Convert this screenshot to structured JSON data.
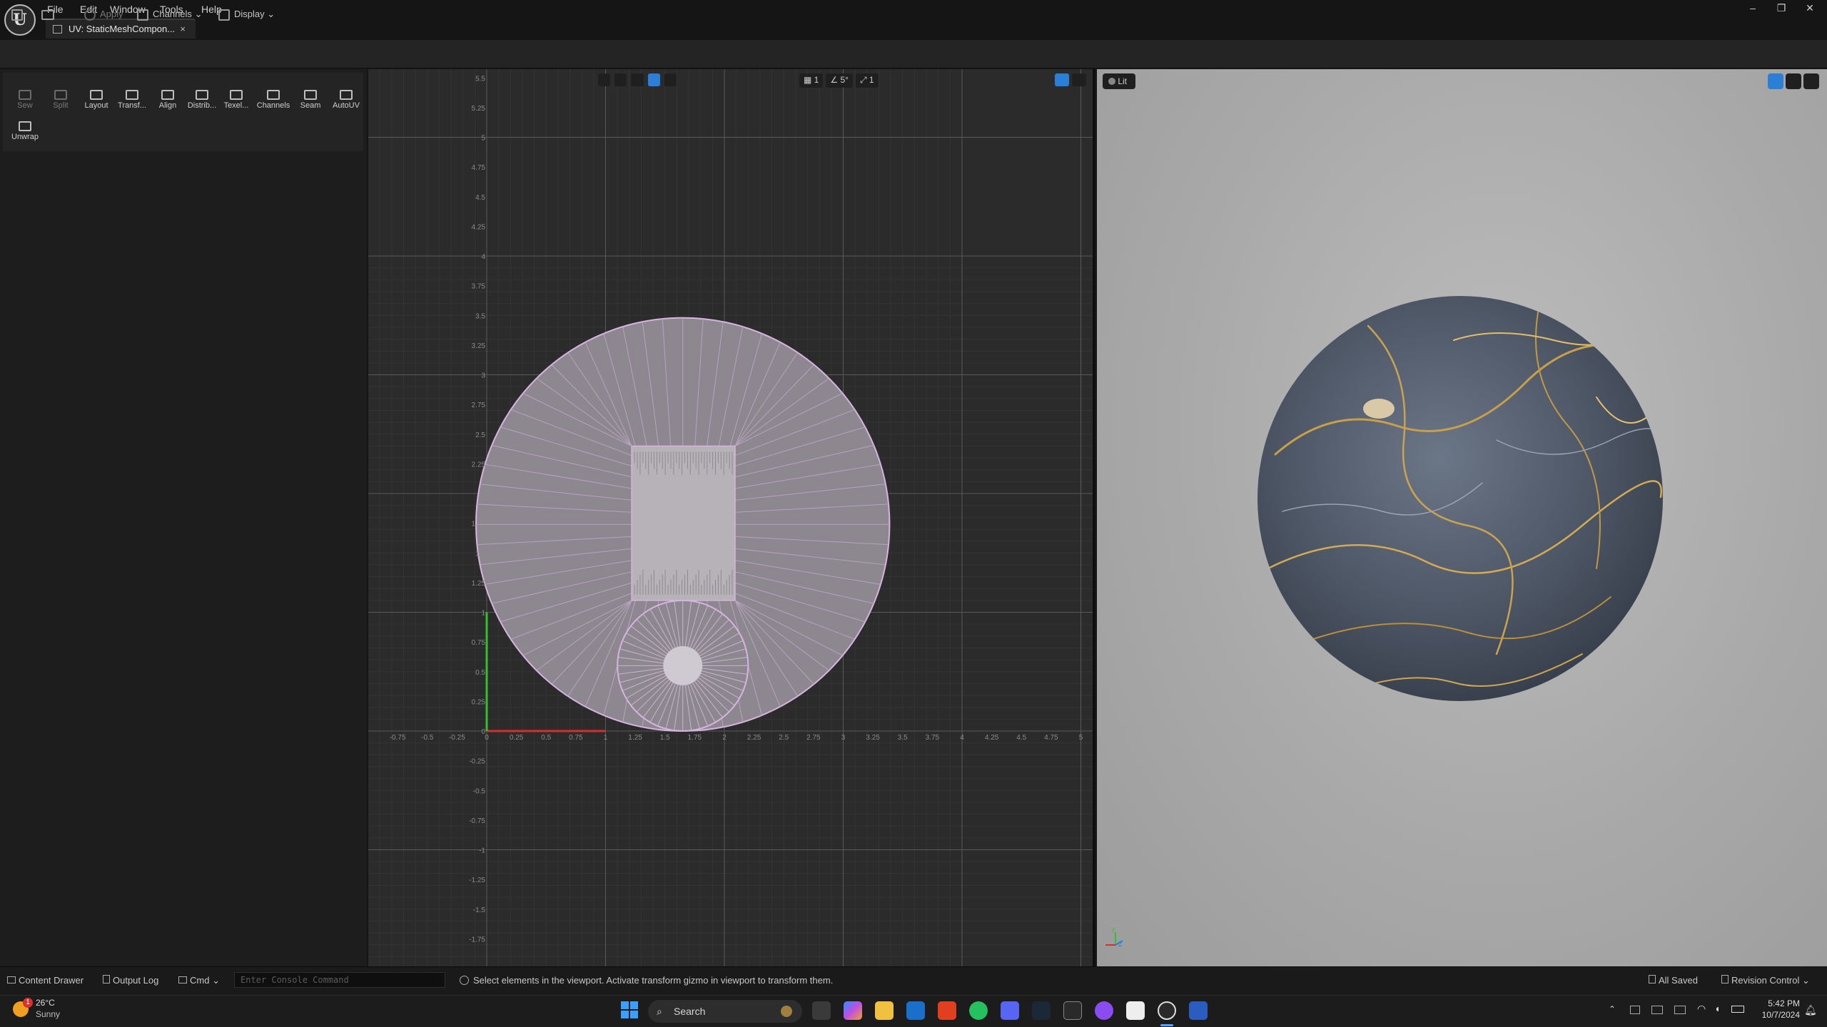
{
  "menu": [
    "File",
    "Edit",
    "Window",
    "Tools",
    "Help"
  ],
  "tab": {
    "title": "UV: StaticMeshCompon...",
    "close": "×"
  },
  "window_controls": {
    "minimize": "–",
    "restore": "❐",
    "close": "✕"
  },
  "toolbar": {
    "apply": "Apply",
    "channels": "Channels",
    "display": "Display"
  },
  "tools": [
    "Sew",
    "Split",
    "Layout",
    "Transf...",
    "Align",
    "Distrib...",
    "Texel...",
    "Channels",
    "Seam",
    "AutoUV",
    "Unwrap"
  ],
  "uv_viewport": {
    "top_toolbar_values": [
      "1",
      "5°",
      "1"
    ],
    "x_ticks": [
      "-0.75",
      "-0.5",
      "-0.25",
      "0",
      "0.25",
      "0.5",
      "0.75",
      "1",
      "1.25",
      "1.5",
      "1.75",
      "2",
      "2.25",
      "2.5",
      "2.75",
      "3",
      "3.25",
      "3.5",
      "3.75",
      "4",
      "4.25",
      "4.5",
      "4.75",
      "5"
    ],
    "y_ticks_pos": [
      "5.5",
      "5.25",
      "5",
      "4.75",
      "4.5",
      "4.25",
      "4",
      "3.75",
      "3.5",
      "3.25",
      "3",
      "2.75",
      "2.5",
      "2.25",
      "2",
      "1.75",
      "1.5",
      "1.25",
      "1",
      "0.75",
      "0.5",
      "0.25",
      "0"
    ],
    "y_ticks_neg": [
      "-0.25",
      "-0.5",
      "-0.75",
      "-1",
      "-1.25",
      "-1.5",
      "-1.75"
    ],
    "uv_fill_color": "#8d8790",
    "uv_edge_color": "#d8b4e0"
  },
  "viewport3d": {
    "mode_label": "Lit",
    "axis_labels": [
      "Y",
      "Z"
    ]
  },
  "statusbar": {
    "content_drawer": "Content Drawer",
    "output_log": "Output Log",
    "cmd": "Cmd",
    "console_placeholder": "Enter Console Command",
    "hint": "Select elements in the viewport. Activate transform gizmo in viewport to transform them.",
    "all_saved": "All Saved",
    "revision_control": "Revision Control"
  },
  "taskbar": {
    "weather_temp": "26°C",
    "weather_desc": "Sunny",
    "weather_badge": "1",
    "search": "Search",
    "time": "5:42 PM",
    "date": "10/7/2024"
  },
  "colors": {
    "accent_blue": "#2b7fd6",
    "axis_red": "#d03030",
    "axis_green": "#30c030"
  }
}
